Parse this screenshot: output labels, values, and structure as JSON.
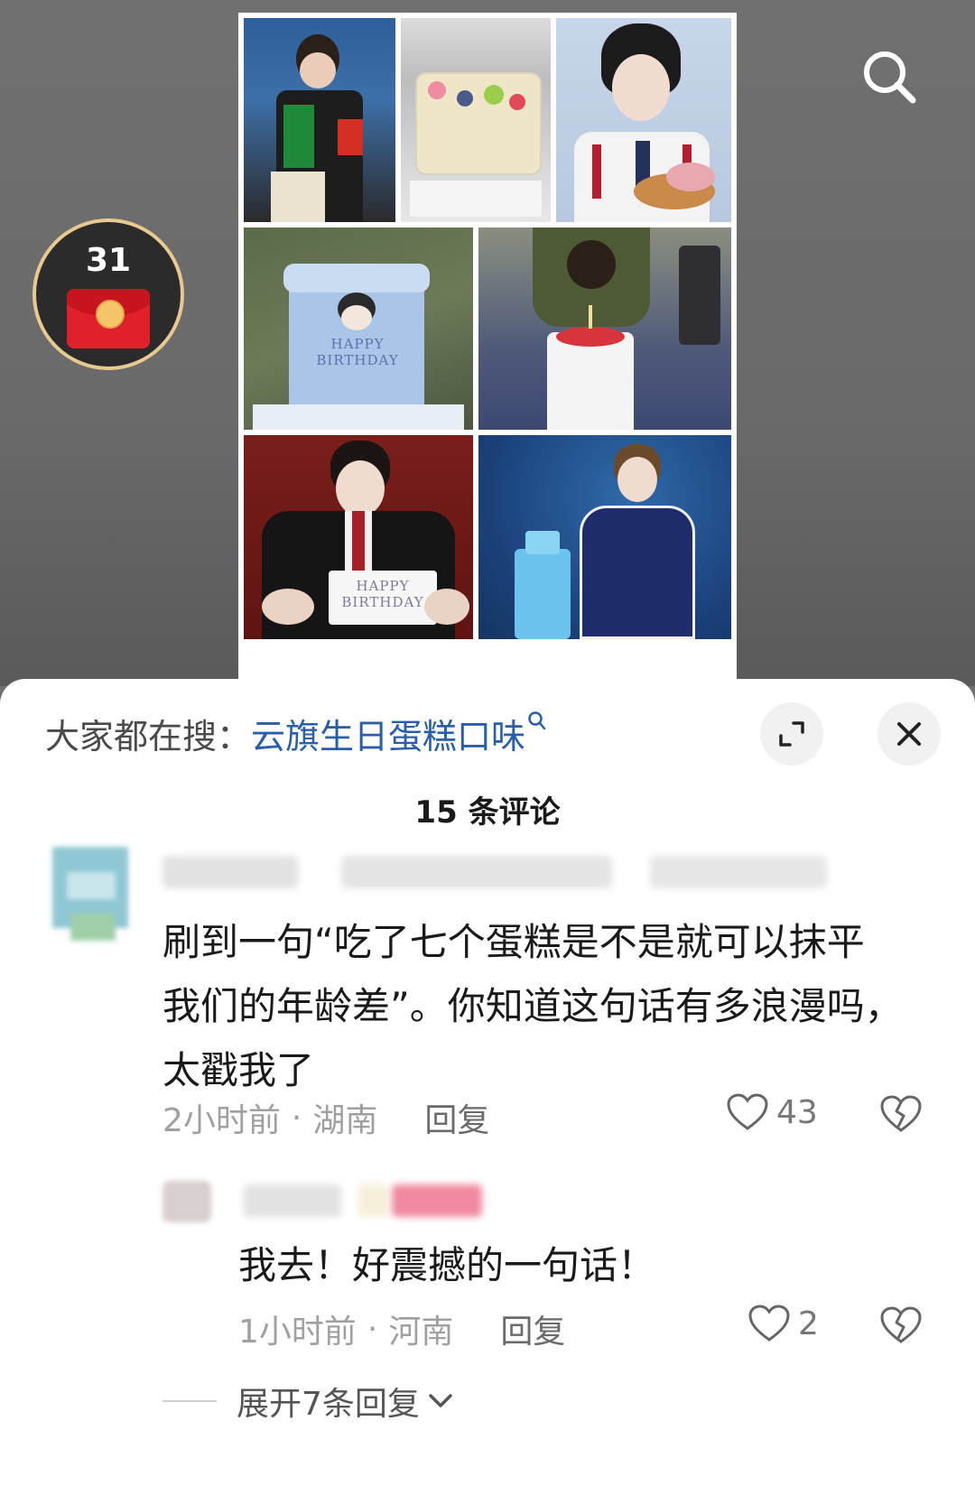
{
  "video": {
    "redpacket_count": "31",
    "cake_label_1": "HAPPY BIRTHDAY",
    "cake_label_2": "HAPPY BIRTHDAY"
  },
  "sheet": {
    "trending_prefix": "大家都在搜：",
    "trending_query": "云旗生日蛋糕口味",
    "comment_count": "15 条评论"
  },
  "comments": [
    {
      "text_line1": "刷到一句“吃了七个蛋糕是不是就可以抹平",
      "text_line2": "我们的年龄差”。你知道这句话有多浪漫吗，",
      "text_line3": "太戳我了",
      "time": "2小时前",
      "location": "湖南",
      "reply_label": "回复",
      "likes": "43"
    }
  ],
  "replies": [
    {
      "text": "我去！好震撼的一句话！",
      "time": "1小时前",
      "location": "河南",
      "reply_label": "回复",
      "likes": "2"
    }
  ],
  "expand_replies": "展开7条回复",
  "colors": {
    "link_blue": "#2a5ea8",
    "redpacket_red": "#e0202a",
    "gold_ring": "#e8c98f"
  }
}
